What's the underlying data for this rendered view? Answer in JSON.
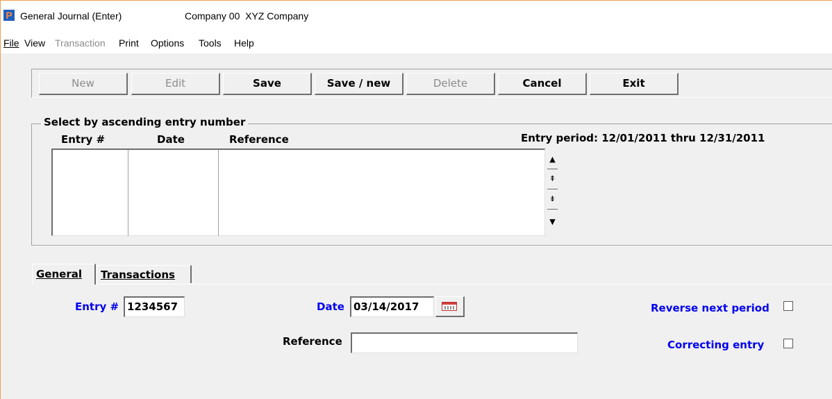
{
  "window": {
    "app_icon": "P",
    "title": "General Journal (Enter)",
    "company": "Company 00  XYZ Company"
  },
  "menu": {
    "file": "File",
    "view": "View",
    "transaction": "Transaction",
    "print": "Print",
    "options": "Options",
    "tools": "Tools",
    "help": "Help"
  },
  "toolbar": {
    "new": "New",
    "edit": "Edit",
    "save": "Save",
    "save_new": "Save / new",
    "delete": "Delete",
    "cancel": "Cancel",
    "exit": "Exit"
  },
  "select_group": {
    "title": "Select by ascending entry number",
    "columns": [
      "Entry #",
      "Date",
      "Reference"
    ],
    "entry_period": "Entry period: 12/01/2011 thru 12/31/2011",
    "rows": []
  },
  "tabs": {
    "general": "General",
    "transactions": "Transactions",
    "active": "General"
  },
  "form": {
    "entry_label": "Entry #",
    "entry_value": "1234567",
    "date_label": "Date",
    "date_value": "03/14/2017",
    "reference_label": "Reference",
    "reference_value": "",
    "reverse_label": "Reverse next period",
    "reverse_checked": false,
    "correcting_label": "Correcting entry",
    "correcting_checked": false
  },
  "icons": {
    "app": "app-logo-icon",
    "calendar": "calendar-icon",
    "scroll_up": "scroll-up-icon",
    "page_up": "page-up-icon",
    "page_down": "page-down-icon",
    "scroll_down": "scroll-down-icon"
  },
  "colors": {
    "label_blue": "#0000ee",
    "window_bg": "#f0f0f0",
    "disabled_text": "#8c8c8c"
  }
}
